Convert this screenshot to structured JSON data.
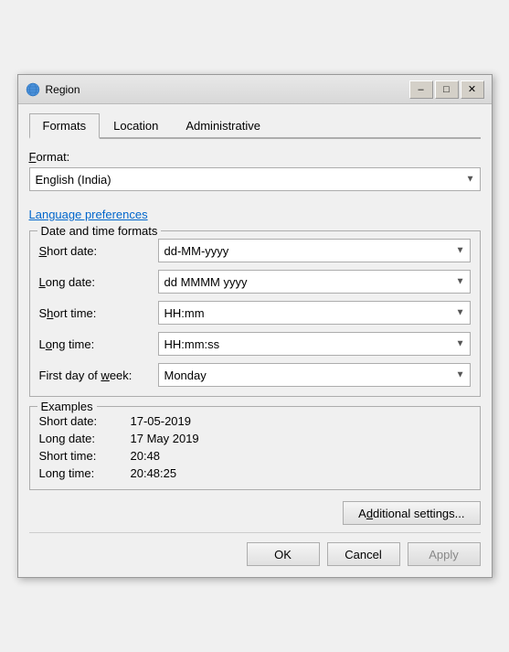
{
  "window": {
    "title": "Region",
    "icon": "globe"
  },
  "tabs": [
    {
      "id": "formats",
      "label": "Formats",
      "active": true
    },
    {
      "id": "location",
      "label": "Location",
      "active": false
    },
    {
      "id": "administrative",
      "label": "Administrative",
      "active": false
    }
  ],
  "formats": {
    "format_label": "Format:",
    "format_underline": "F",
    "format_value": "English (India)",
    "lang_link": "Language preferences",
    "date_time_group": "Date and time formats",
    "fields": [
      {
        "id": "short-date",
        "label": "Short date:",
        "underline": "S",
        "value": "dd-MM-yyyy"
      },
      {
        "id": "long-date",
        "label": "Long date:",
        "underline": "L",
        "value": "dd MMMM yyyy"
      },
      {
        "id": "short-time",
        "label": "Short time:",
        "underline": "h",
        "value": "HH:mm"
      },
      {
        "id": "long-time",
        "label": "Long time:",
        "underline": "o",
        "value": "HH:mm:ss"
      },
      {
        "id": "first-day",
        "label": "First day of week:",
        "underline": "w",
        "value": "Monday"
      }
    ],
    "examples_group": "Examples",
    "examples": [
      {
        "label": "Short date:",
        "value": "17-05-2019"
      },
      {
        "label": "Long date:",
        "value": "17 May 2019"
      },
      {
        "label": "Short time:",
        "value": "20:48"
      },
      {
        "label": "Long time:",
        "value": "20:48:25"
      }
    ],
    "additional_btn": "Additional settings...",
    "additional_btn_underline": "d",
    "ok_btn": "OK",
    "cancel_btn": "Cancel",
    "apply_btn": "Apply"
  }
}
